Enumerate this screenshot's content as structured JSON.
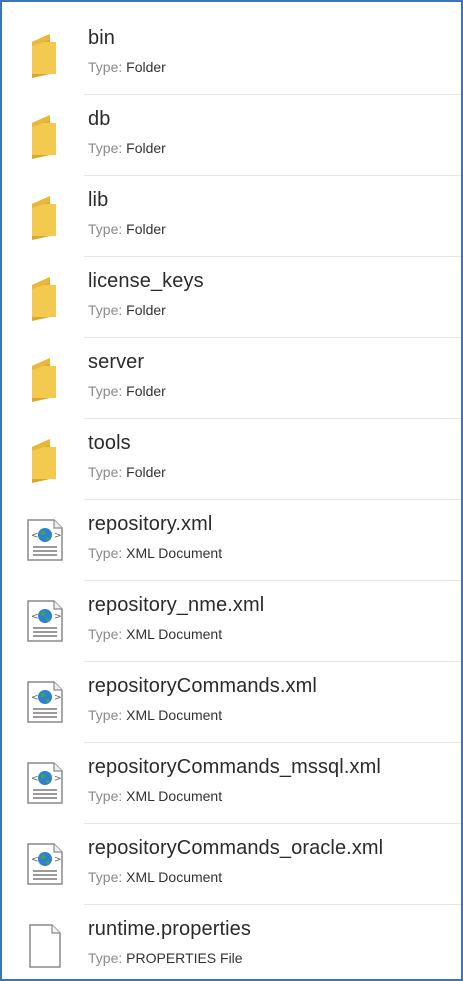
{
  "type_label": "Type:",
  "items": [
    {
      "name": "bin",
      "type": "Folder",
      "icon": "folder-icon"
    },
    {
      "name": "db",
      "type": "Folder",
      "icon": "folder-icon"
    },
    {
      "name": "lib",
      "type": "Folder",
      "icon": "folder-icon"
    },
    {
      "name": "license_keys",
      "type": "Folder",
      "icon": "folder-icon"
    },
    {
      "name": "server",
      "type": "Folder",
      "icon": "folder-icon"
    },
    {
      "name": "tools",
      "type": "Folder",
      "icon": "folder-icon"
    },
    {
      "name": "repository.xml",
      "type": "XML Document",
      "icon": "xml-document-icon"
    },
    {
      "name": "repository_nme.xml",
      "type": "XML Document",
      "icon": "xml-document-icon"
    },
    {
      "name": "repositoryCommands.xml",
      "type": "XML Document",
      "icon": "xml-document-icon"
    },
    {
      "name": "repositoryCommands_mssql.xml",
      "type": "XML Document",
      "icon": "xml-document-icon"
    },
    {
      "name": "repositoryCommands_oracle.xml",
      "type": "XML Document",
      "icon": "xml-document-icon"
    },
    {
      "name": "runtime.properties",
      "type": "PROPERTIES File",
      "icon": "blank-file-icon"
    }
  ],
  "colors": {
    "border": "#3c73b9",
    "folder": "#f3c94f",
    "folder_dark": "#dca52b",
    "globe": "#2f7fd2",
    "globe_green": "#3aa94a"
  }
}
